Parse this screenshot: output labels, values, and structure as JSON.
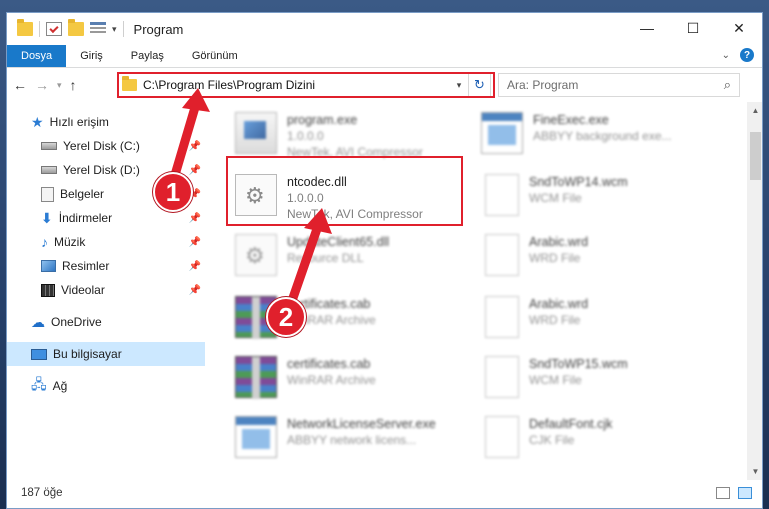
{
  "window": {
    "title": "Program"
  },
  "ribbon": {
    "tabs": [
      "Dosya",
      "Giriş",
      "Paylaş",
      "Görünüm"
    ]
  },
  "address": {
    "path": "C:\\Program Files\\Program Dizini"
  },
  "search": {
    "placeholder": "Ara: Program"
  },
  "sidebar": {
    "quick_access": "Hızlı erişim",
    "items": [
      {
        "label": "Yerel Disk (C:)",
        "icon": "drive-icon",
        "pinned": true
      },
      {
        "label": "Yerel Disk (D:)",
        "icon": "drive-icon",
        "pinned": true
      },
      {
        "label": "Belgeler",
        "icon": "documents-icon",
        "pinned": true
      },
      {
        "label": "İndirmeler",
        "icon": "download-icon",
        "pinned": true
      },
      {
        "label": "Müzik",
        "icon": "music-icon",
        "pinned": true
      },
      {
        "label": "Resimler",
        "icon": "pictures-icon",
        "pinned": true
      },
      {
        "label": "Videolar",
        "icon": "videos-icon",
        "pinned": true
      }
    ],
    "onedrive": "OneDrive",
    "this_pc": "Bu bilgisayar",
    "network": "Ağ"
  },
  "files": [
    {
      "name": "program.exe",
      "line2": "1.0.0.0",
      "line3": "NewTek, AVI Compressor",
      "icon": "exe-icon",
      "blurred": true
    },
    {
      "name": "FineExec.exe",
      "line2": "ABBYY background exe...",
      "line3": "",
      "icon": "app-icon",
      "blurred": true
    },
    {
      "name": "ntcodec.dll",
      "line2": "1.0.0.0",
      "line3": "NewTek, AVI Compressor",
      "icon": "dll-icon",
      "blurred": false
    },
    {
      "name": "SndToWP14.wcm",
      "line2": "WCM File",
      "line3": "",
      "icon": "document-icon",
      "blurred": true
    },
    {
      "name": "UpdateClient65.dll",
      "line2": "Resource DLL",
      "line3": "",
      "icon": "dll-icon",
      "blurred": true
    },
    {
      "name": "Arabic.wrd",
      "line2": "WRD File",
      "line3": "",
      "icon": "document-icon",
      "blurred": true
    },
    {
      "name": "certificates.cab",
      "line2": "WinRAR Archive",
      "line3": "",
      "icon": "archive-icon",
      "blurred": true
    },
    {
      "name": "Arabic.wrd",
      "line2": "WRD File",
      "line3": "",
      "icon": "document-icon",
      "blurred": true
    },
    {
      "name": "certificates.cab",
      "line2": "WinRAR Archive",
      "line3": "",
      "icon": "archive-icon",
      "blurred": true
    },
    {
      "name": "SndToWP15.wcm",
      "line2": "WCM File",
      "line3": "",
      "icon": "document-icon",
      "blurred": true
    },
    {
      "name": "NetworkLicenseServer.exe",
      "line2": "ABBYY network licens...",
      "line3": "",
      "icon": "app-icon",
      "blurred": true
    },
    {
      "name": "DefaultFont.cjk",
      "line2": "CJK File",
      "line3": "",
      "icon": "document-icon",
      "blurred": true
    }
  ],
  "status": {
    "count": "187 öğe"
  },
  "annotations": {
    "step1": "1",
    "step2": "2",
    "color": "#e0202c"
  }
}
